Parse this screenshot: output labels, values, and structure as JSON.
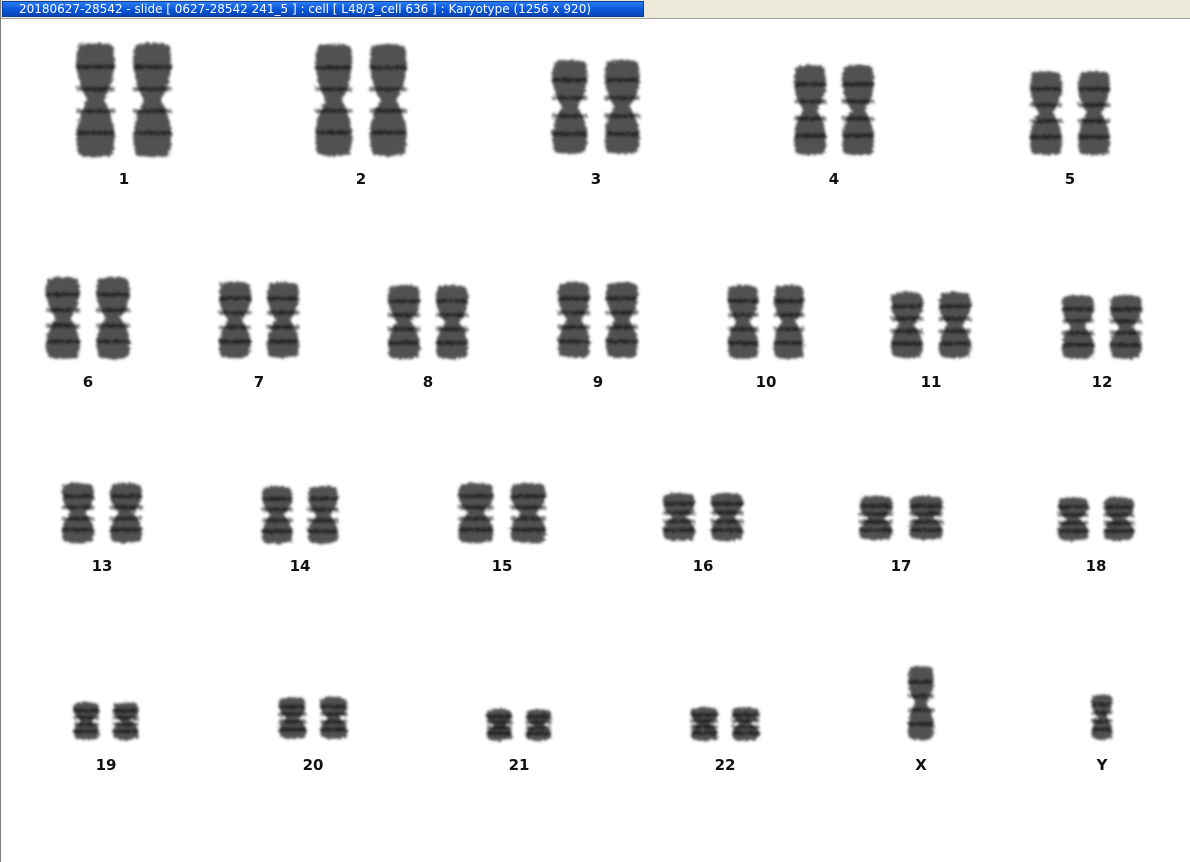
{
  "window": {
    "title": "20180627-28542 - slide [ 0627-28542 241_5 ] : cell [ L48/3_cell 636 ] : Karyotype  (1256 x 920)"
  },
  "colors": {
    "title_bar": "#0a57d9",
    "title_text": "#ffffff",
    "chromosome": "#2a2a2a",
    "background": "#ffffff"
  },
  "karyotype": {
    "chromosomes": [
      {
        "label": "1"
      },
      {
        "label": "2"
      },
      {
        "label": "3"
      },
      {
        "label": "4"
      },
      {
        "label": "5"
      },
      {
        "label": "6"
      },
      {
        "label": "7"
      },
      {
        "label": "8"
      },
      {
        "label": "9"
      },
      {
        "label": "10"
      },
      {
        "label": "11"
      },
      {
        "label": "12"
      },
      {
        "label": "13"
      },
      {
        "label": "14"
      },
      {
        "label": "15"
      },
      {
        "label": "16"
      },
      {
        "label": "17"
      },
      {
        "label": "18"
      },
      {
        "label": "19"
      },
      {
        "label": "20"
      },
      {
        "label": "21"
      },
      {
        "label": "22"
      },
      {
        "label": "X"
      },
      {
        "label": "Y"
      }
    ]
  }
}
